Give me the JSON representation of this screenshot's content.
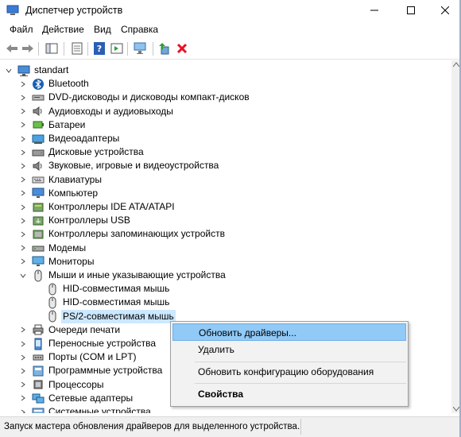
{
  "window": {
    "title": "Диспетчер устройств",
    "minimize": "—",
    "maximize": "☐",
    "close": "✕"
  },
  "menu": {
    "items": [
      "Файл",
      "Действие",
      "Вид",
      "Справка"
    ]
  },
  "toolbar": {
    "buttons": [
      "back-icon",
      "forward-icon",
      "show-hide-console-tree-icon",
      "properties-icon",
      "help-icon",
      "action-pane-icon",
      "scan-hardware-icon",
      "update-driver-icon",
      "uninstall-icon"
    ]
  },
  "tree": {
    "root": "standart",
    "items": [
      {
        "label": "Bluetooth",
        "icon": "bluetooth-icon"
      },
      {
        "label": "DVD-дисководы и дисководы компакт-дисков",
        "icon": "dvd-drive-icon"
      },
      {
        "label": "Аудиовходы и аудиовыходы",
        "icon": "speaker-icon"
      },
      {
        "label": "Батареи",
        "icon": "battery-icon"
      },
      {
        "label": "Видеоадаптеры",
        "icon": "display-adapter-icon"
      },
      {
        "label": "Дисковые устройства",
        "icon": "disk-drive-icon"
      },
      {
        "label": "Звуковые, игровые и видеоустройства",
        "icon": "speaker-icon"
      },
      {
        "label": "Клавиатуры",
        "icon": "keyboard-icon"
      },
      {
        "label": "Компьютер",
        "icon": "computer-icon"
      },
      {
        "label": "Контроллеры IDE ATA/ATAPI",
        "icon": "ide-controller-icon"
      },
      {
        "label": "Контроллеры USB",
        "icon": "usb-icon"
      },
      {
        "label": "Контроллеры запоминающих устройств",
        "icon": "storage-controller-icon"
      },
      {
        "label": "Модемы",
        "icon": "modem-icon"
      },
      {
        "label": "Мониторы",
        "icon": "monitor-icon"
      },
      {
        "label": "Мыши и иные указывающие устройства",
        "icon": "mouse-icon"
      },
      {
        "label": "HID-совместимая мышь",
        "icon": "mouse-icon"
      },
      {
        "label": "HID-совместимая мышь",
        "icon": "mouse-icon"
      },
      {
        "label": "PS/2-совместимая мышь",
        "icon": "mouse-icon"
      },
      {
        "label": "Очереди печати",
        "icon": "printer-icon"
      },
      {
        "label": "Переносные устройства",
        "icon": "portable-device-icon"
      },
      {
        "label": "Порты (COM и LPT)",
        "icon": "port-icon"
      },
      {
        "label": "Программные устройства",
        "icon": "software-device-icon"
      },
      {
        "label": "Процессоры",
        "icon": "processor-icon"
      },
      {
        "label": "Сетевые адаптеры",
        "icon": "network-adapter-icon"
      },
      {
        "label": "Системные устройства",
        "icon": "system-device-icon"
      }
    ]
  },
  "context_menu": {
    "items": [
      "Обновить драйверы...",
      "Удалить",
      "Обновить конфигурацию оборудования",
      "Свойства"
    ]
  },
  "status": {
    "text": "Запуск мастера обновления драйверов для выделенного устройства."
  },
  "colors": {
    "selection": "#cce8ff",
    "menu_highlight": "#91c9f7",
    "uninstall_red": "#e81123"
  }
}
